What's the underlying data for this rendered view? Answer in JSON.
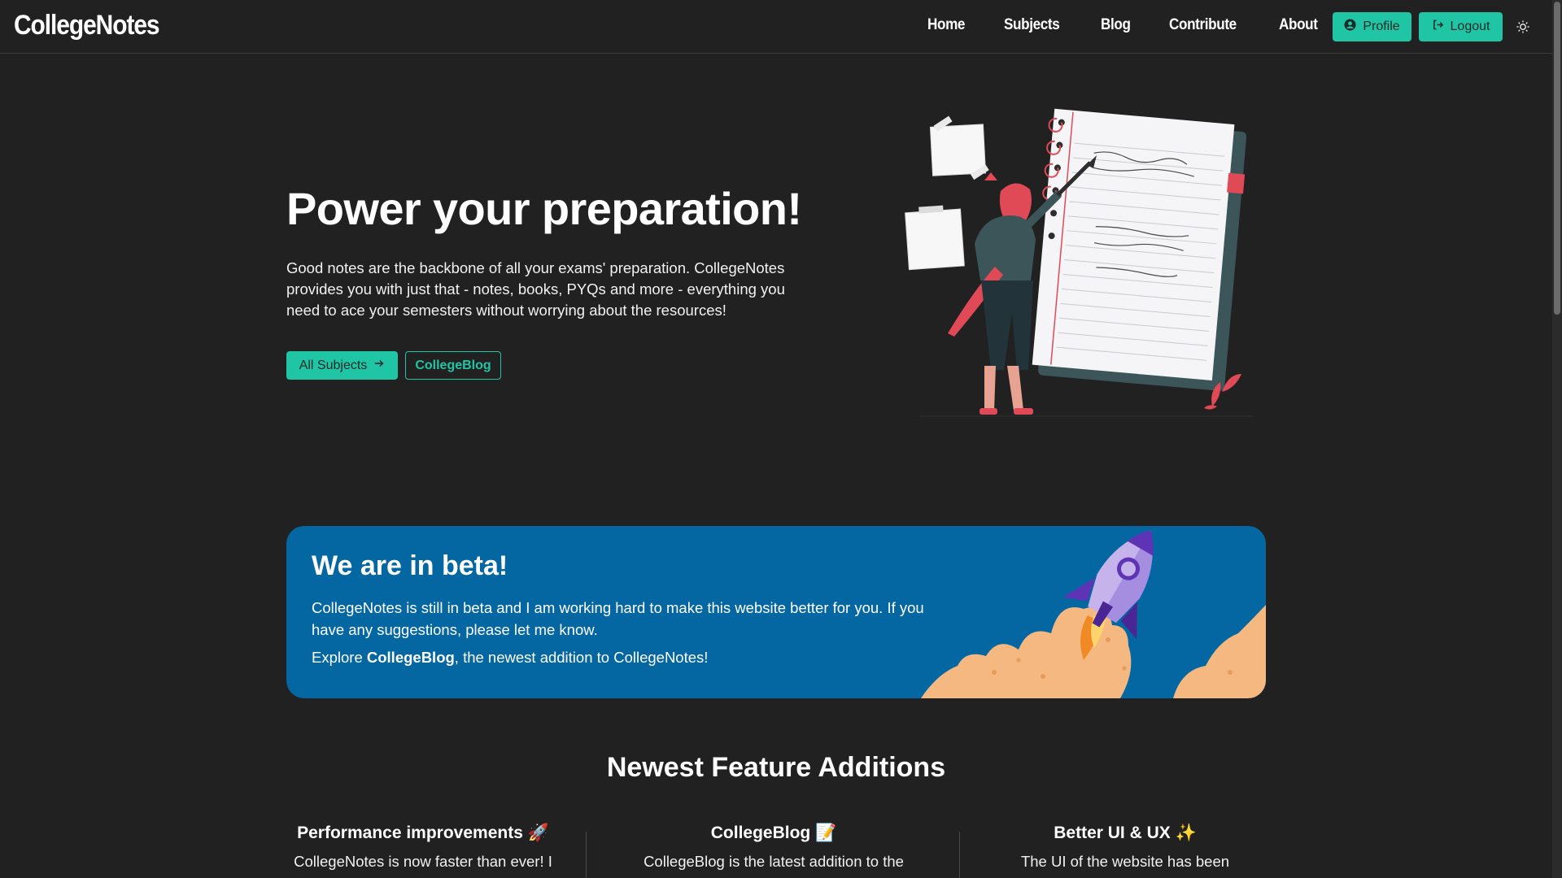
{
  "brand": {
    "name": "CollegeNotes"
  },
  "nav": {
    "links": [
      "Home",
      "Subjects",
      "Blog",
      "Contribute",
      "About"
    ],
    "profile_label": "Profile",
    "logout_label": "Logout",
    "theme_icon": "sun-icon"
  },
  "hero": {
    "title": "Power your preparation!",
    "description": "Good notes are the backbone of all your exams' preparation. CollegeNotes provides you with just that - notes, books, PYQs and more - everything you need to ace your semesters without worrying about the resources!",
    "primary_button": "All Subjects",
    "secondary_button": "CollegeBlog"
  },
  "beta": {
    "title": "We are in beta!",
    "text": "CollegeNotes is still in beta and I am working hard to make this website better for you. If you have any suggestions, please let me know.",
    "explore_prefix": "Explore ",
    "explore_bold": "CollegeBlog",
    "explore_suffix": ", the newest addition to CollegeNotes!"
  },
  "features": {
    "title": "Newest Feature Additions",
    "items": [
      {
        "title": "Performance improvements 🚀",
        "text": "CollegeNotes is now faster than ever! I"
      },
      {
        "title": "CollegeBlog 📝",
        "text": "CollegeBlog is the latest addition to the"
      },
      {
        "title": "Better UI & UX ✨",
        "text": "The UI of the website has been"
      }
    ]
  },
  "colors": {
    "background": "#212121",
    "accent": "#20c5a5",
    "banner": "#0467a2"
  }
}
